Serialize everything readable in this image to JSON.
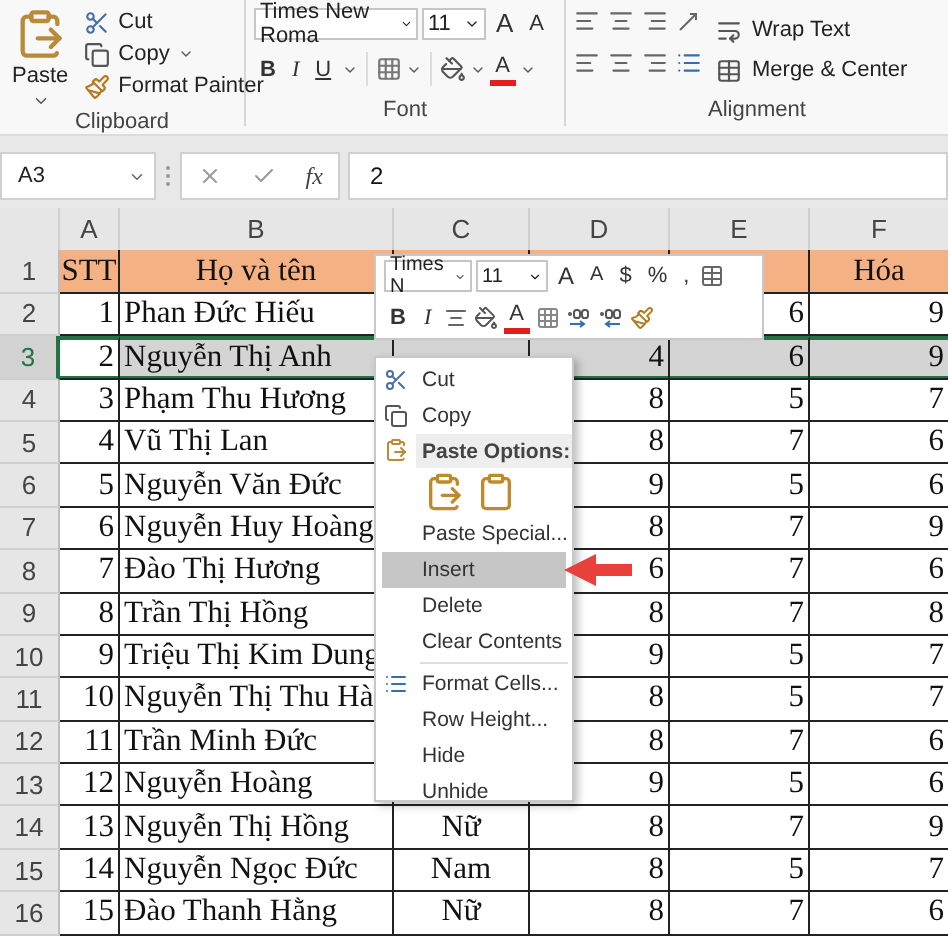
{
  "ribbon": {
    "clipboard": {
      "label": "Clipboard",
      "paste": "Paste",
      "commands": [
        "Cut",
        "Copy",
        "Format Painter"
      ]
    },
    "font": {
      "label": "Font",
      "font_name": "Times New Roma",
      "font_size": "11",
      "size_buttons": [
        "A",
        "A"
      ],
      "style_buttons": [
        "B",
        "I",
        "U"
      ],
      "font_color": "A"
    },
    "alignment": {
      "label": "Alignment",
      "commands": [
        "Wrap Text",
        "Merge & Center"
      ]
    }
  },
  "formula_bar": {
    "name_box": "A3",
    "function_label": "fx",
    "value": "2"
  },
  "sheet": {
    "columns": [
      "A",
      "B",
      "C",
      "D",
      "E",
      "F"
    ],
    "rows": [
      {
        "header": "1",
        "kind": "heading",
        "selected": false,
        "cells": [
          "STT",
          "Họ và tên",
          null,
          null,
          null,
          "Hóa"
        ]
      },
      {
        "header": "2",
        "kind": "data",
        "selected": false,
        "cells": [
          "1",
          "Phan Đức Hiếu",
          null,
          null,
          "6",
          "9"
        ]
      },
      {
        "header": "3",
        "kind": "data",
        "selected": true,
        "cells": [
          "2",
          "Nguyễn Thị Anh",
          null,
          "4",
          "6",
          "9"
        ]
      },
      {
        "header": "4",
        "kind": "data",
        "selected": false,
        "cells": [
          "3",
          "Phạm Thu Hương",
          null,
          "8",
          "5",
          "7"
        ]
      },
      {
        "header": "5",
        "kind": "data",
        "selected": false,
        "cells": [
          "4",
          "Vũ Thị Lan",
          null,
          "8",
          "7",
          "6"
        ]
      },
      {
        "header": "6",
        "kind": "data",
        "selected": false,
        "cells": [
          "5",
          "Nguyễn Văn Đức",
          null,
          "9",
          "5",
          "6"
        ]
      },
      {
        "header": "7",
        "kind": "data",
        "selected": false,
        "cells": [
          "6",
          "Nguyễn Huy Hoàng",
          null,
          "8",
          "7",
          "9"
        ]
      },
      {
        "header": "8",
        "kind": "data",
        "selected": false,
        "cells": [
          "7",
          "Đào Thị Hương",
          null,
          "6",
          "7",
          "6"
        ]
      },
      {
        "header": "9",
        "kind": "data",
        "selected": false,
        "cells": [
          "8",
          "Trần Thị Hồng",
          null,
          "8",
          "7",
          "8"
        ]
      },
      {
        "header": "10",
        "kind": "data",
        "selected": false,
        "cells": [
          "9",
          "Triệu Thị Kim Dung",
          null,
          "9",
          "5",
          "7"
        ]
      },
      {
        "header": "11",
        "kind": "data",
        "selected": false,
        "cells": [
          "10",
          "Nguyễn Thị Thu Hà",
          null,
          "8",
          "5",
          "7"
        ]
      },
      {
        "header": "12",
        "kind": "data",
        "selected": false,
        "cells": [
          "11",
          "Trần Minh Đức",
          null,
          "8",
          "7",
          "6"
        ]
      },
      {
        "header": "13",
        "kind": "data",
        "selected": false,
        "cells": [
          "12",
          "Nguyễn Hoàng",
          null,
          "9",
          "5",
          "6"
        ]
      },
      {
        "header": "14",
        "kind": "data",
        "selected": false,
        "cells": [
          "13",
          "Nguyễn Thị Hồng",
          "Nữ",
          "8",
          "7",
          "9"
        ]
      },
      {
        "header": "15",
        "kind": "data",
        "selected": false,
        "cells": [
          "14",
          "Nguyễn Ngọc Đức",
          "Nam",
          "8",
          "5",
          "7"
        ]
      },
      {
        "header": "16",
        "kind": "data",
        "selected": false,
        "cells": [
          "15",
          "Đào Thanh Hằng",
          "Nữ",
          "8",
          "7",
          "6"
        ]
      }
    ]
  },
  "mini_toolbar": {
    "font_name": "Times N",
    "font_size": "11",
    "size_buttons": [
      "A",
      "A"
    ],
    "number_buttons": [
      "$",
      "%",
      ","
    ],
    "style_buttons": [
      "B",
      "I"
    ],
    "font_color": "A"
  },
  "context_menu": {
    "items": [
      {
        "kind": "command",
        "label": "Cut",
        "selected": false
      },
      {
        "kind": "command",
        "label": "Copy",
        "selected": false
      },
      {
        "kind": "heading",
        "label": "Paste Options:"
      },
      {
        "kind": "paste-icons"
      },
      {
        "kind": "command",
        "label": "Paste Special...",
        "selected": false
      },
      {
        "kind": "command",
        "label": "Insert",
        "selected": true
      },
      {
        "kind": "command",
        "label": "Delete",
        "selected": false
      },
      {
        "kind": "command",
        "label": "Clear Contents",
        "selected": false
      },
      {
        "kind": "separator"
      },
      {
        "kind": "command",
        "label": "Format Cells...",
        "selected": false
      },
      {
        "kind": "command",
        "label": "Row Height...",
        "selected": false
      },
      {
        "kind": "command",
        "label": "Hide",
        "selected": false
      },
      {
        "kind": "command",
        "label": "Unhide",
        "selected": false
      }
    ]
  }
}
